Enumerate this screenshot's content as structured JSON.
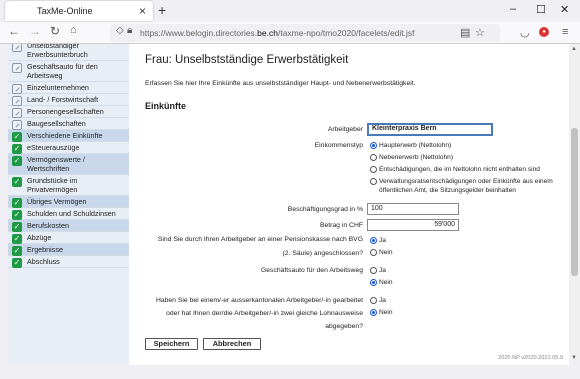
{
  "browser": {
    "tab_title": "TaxMe-Online",
    "url_prefix": "https://www.belogin.directories.",
    "url_domain": "be.ch",
    "url_suffix": "/taxme-npo/tmo2020/facelets/edit.jsf"
  },
  "sidebar": {
    "items": [
      {
        "label": "Unselbständiger Erwerbsunterbruch",
        "icon": "gray",
        "dark": false
      },
      {
        "label": "Geschäftsauto für den Arbeitsweg",
        "icon": "gray",
        "dark": false
      },
      {
        "label": "Einzelunternehmen",
        "icon": "gray",
        "dark": false
      },
      {
        "label": "Land- / Forstwirtschaft",
        "icon": "gray",
        "dark": false
      },
      {
        "label": "Personengesellschaften",
        "icon": "gray",
        "dark": false
      },
      {
        "label": "Baugesellschaften",
        "icon": "gray",
        "dark": false
      },
      {
        "label": "Verschiedene Einkünfte",
        "icon": "green",
        "dark": true
      },
      {
        "label": "eSteuerauszüge",
        "icon": "green",
        "dark": false
      },
      {
        "label": "Vermögenswerte / Wertschriften",
        "icon": "green",
        "dark": true
      },
      {
        "label": "Grundstücke im Privatvermögen",
        "icon": "green",
        "dark": false
      },
      {
        "label": "Übriges Vermögen",
        "icon": "green",
        "dark": true
      },
      {
        "label": "Schulden und Schuldzinsen",
        "icon": "green",
        "dark": false
      },
      {
        "label": "Berufskosten",
        "icon": "green",
        "dark": true
      },
      {
        "label": "Abzüge",
        "icon": "green",
        "dark": false
      },
      {
        "label": "Ergebnisse",
        "icon": "green",
        "dark": true
      },
      {
        "label": "Abschluss",
        "icon": "green",
        "dark": false
      }
    ]
  },
  "main": {
    "title": "Frau: Unselbstständige Erwerbstätigkeit",
    "intro": "Erfassen Sie hier Ihre Einkünfte aus unselbstständiger Haupt- und Nebenerwerbstätigkeit.",
    "section": "Einkünfte",
    "arbeitgeber_label": "Arbeitgeber",
    "arbeitgeber_value": "Kleinterpraxis Bern",
    "einkommenstyp_label": "Einkommenstyp",
    "einkommenstyp_options": [
      "Haupterwerb (Nettolohn)",
      "Nebenerwerb (Nettolohn)",
      "Entschädigungen, die im Nettolohn nicht enthalten sind",
      "Verwaltungsratsentschädigungen oder Einkünfte aus einem öffentlichen Amt, die Sitzungsgelder beinhalten"
    ],
    "einkommenstyp_selected": 0,
    "grad_label": "Beschäftigungsgrad in %",
    "grad_value": "100",
    "betrag_label": "Betrag in CHF",
    "betrag_value": "59'000",
    "q1_line1": "Sind Sie durch Ihren Arbeitgeber an einer Pensionskasse nach BVG",
    "q1_line2": "(2. Säule) angeschlossen?",
    "q1_selected": "Ja",
    "q2": "Geschäftsauto für den Arbeitsweg",
    "q2_selected": "Nein",
    "q3_line1": "Haben Sie bei einem/-er ausserkantonalen Arbeitgeber/-in gearbeitet",
    "q3_line2": "oder hat Ihnen der/die Arbeitgeber/-in zwei gleiche Lohnausweise",
    "q3_line3": "abgegeben?",
    "q3_selected": "Nein",
    "ja": "Ja",
    "nein": "Nein",
    "save_label": "Speichern",
    "cancel_label": "Abbrechen",
    "version": "2020 NP v2020.2021.05.9"
  },
  "colors": {
    "accent": "#1a56d6",
    "sidebar_bg": "#e7eef6",
    "check_green": "#1d9a43"
  }
}
